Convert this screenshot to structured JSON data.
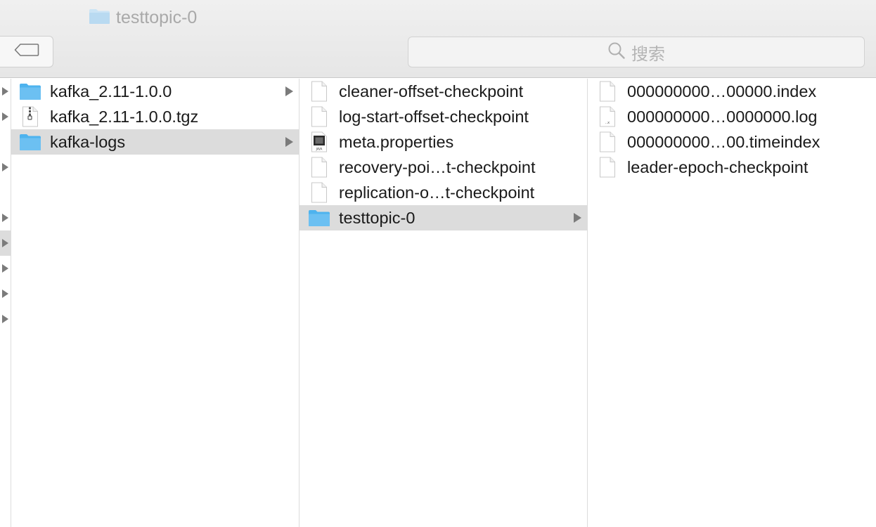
{
  "window": {
    "title": "testtopic-0"
  },
  "search": {
    "placeholder": "搜索"
  },
  "columns": [
    {
      "items": [
        {
          "label": "kafka_2.11-1.0.0",
          "icon": "folder-icon",
          "has_children": true,
          "selected": false
        },
        {
          "label": "kafka_2.11-1.0.0.tgz",
          "icon": "archive-file-icon",
          "has_children": false,
          "selected": false
        },
        {
          "label": "kafka-logs",
          "icon": "folder-icon",
          "has_children": true,
          "selected": true
        }
      ]
    },
    {
      "items": [
        {
          "label": "cleaner-offset-checkpoint",
          "icon": "document-icon",
          "has_children": false,
          "selected": false
        },
        {
          "label": "log-start-offset-checkpoint",
          "icon": "document-icon",
          "has_children": false,
          "selected": false
        },
        {
          "label": "meta.properties",
          "icon": "java-properties-file-icon",
          "has_children": false,
          "selected": false
        },
        {
          "label": "recovery-poi…t-checkpoint",
          "icon": "document-icon",
          "has_children": false,
          "selected": false
        },
        {
          "label": "replication-o…t-checkpoint",
          "icon": "document-icon",
          "has_children": false,
          "selected": false
        },
        {
          "label": "testtopic-0",
          "icon": "folder-icon",
          "has_children": true,
          "selected": true
        }
      ]
    },
    {
      "items": [
        {
          "label": "000000000…00000.index",
          "icon": "document-icon",
          "has_children": false,
          "selected": false
        },
        {
          "label": "000000000…0000000.log",
          "icon": "log-file-icon",
          "has_children": false,
          "selected": false
        },
        {
          "label": "000000000…00.timeindex",
          "icon": "document-icon",
          "has_children": false,
          "selected": false
        },
        {
          "label": "leader-epoch-checkpoint",
          "icon": "document-icon",
          "has_children": false,
          "selected": false
        }
      ]
    }
  ],
  "colors": {
    "selection": "#dcdcdc",
    "folder": "#6cc0f2",
    "arrow": "#7b7b7b"
  }
}
